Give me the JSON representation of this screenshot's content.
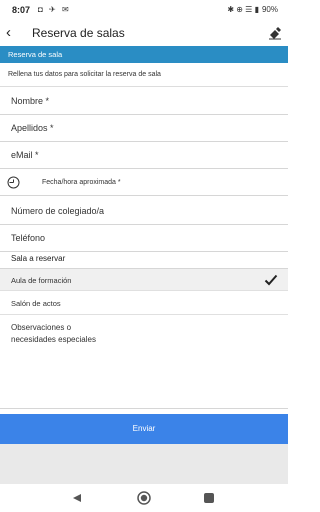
{
  "status_bar": {
    "time": "8:07",
    "left_icons": "◘ ✈ ✉",
    "right_icons": "✱ ⊕ ☰ ▮",
    "battery": "90%"
  },
  "app_bar": {
    "title": "Reserva de salas"
  },
  "section_header": "Reserva de sala",
  "intro": "Rellena tus datos para solicitar la reserva de sala",
  "fields": {
    "nombre": "Nombre *",
    "apellidos": "Apellidos *",
    "email": "eMail *",
    "fecha": "Fecha/hora aproximada *",
    "colegiado": "Número de colegiado/a",
    "telefono": "Teléfono"
  },
  "room": {
    "title": "Sala a reservar",
    "options": [
      {
        "label": "Aula de formación",
        "selected": true
      },
      {
        "label": "Salón de actos",
        "selected": false
      }
    ]
  },
  "observaciones": {
    "line1": "Observaciones o",
    "line2": "necesidades especiales"
  },
  "submit_label": "Enviar",
  "colors": {
    "header_blue": "#2a8dc4",
    "button_blue": "#3b83e8"
  }
}
